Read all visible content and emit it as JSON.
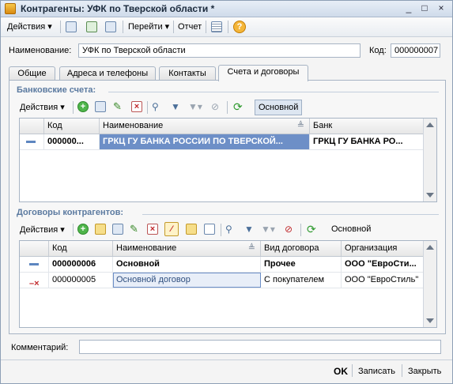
{
  "window": {
    "title": "Контрагенты: УФК по Тверской области *",
    "buttons": [
      "_",
      "□",
      "×"
    ]
  },
  "toolbar": {
    "actions_label": "Действия",
    "goto_label": "Перейти",
    "report_label": "Отчет",
    "help_label": "?"
  },
  "form": {
    "name_label": "Наименование:",
    "name_value": "УФК по Тверской области",
    "code_label": "Код:",
    "code_value": "000000007",
    "comment_label": "Комментарий:",
    "comment_value": ""
  },
  "tabs": [
    {
      "label": "Общие"
    },
    {
      "label": "Адреса и телефоны"
    },
    {
      "label": "Контакты"
    },
    {
      "label": "Счета и договоры"
    }
  ],
  "bank_accounts": {
    "title": "Банковские счета:",
    "actions_label": "Действия",
    "main_label": "Основной",
    "columns": [
      "Код",
      "Наименование",
      "Банк"
    ],
    "rows": [
      {
        "code": "000000...",
        "name": "ГРКЦ ГУ БАНКА РОССИИ ПО ТВЕРСКОЙ...",
        "bank": "ГРКЦ ГУ БАНКА РО..."
      }
    ]
  },
  "contracts": {
    "title": "Договоры контрагентов:",
    "actions_label": "Действия",
    "main_label": "Основной",
    "columns": [
      "Код",
      "Наименование",
      "Вид договора",
      "Организация"
    ],
    "rows": [
      {
        "code": "000000006",
        "name": "Основной",
        "type": "Прочее",
        "org": "ООО \"ЕвроСти..."
      },
      {
        "code": "000000005",
        "name": "Основной договор",
        "type": "С покупателем",
        "org": "ООО \"ЕвроСтиль\""
      }
    ]
  },
  "footer": {
    "ok_label": "OK",
    "save_label": "Записать",
    "close_label": "Закрыть"
  },
  "colors": {
    "selection": "#6d8fc7",
    "section_title": "#5b7aa0",
    "accent_green": "#2f9a2f",
    "delete_red": "#c0282b"
  }
}
